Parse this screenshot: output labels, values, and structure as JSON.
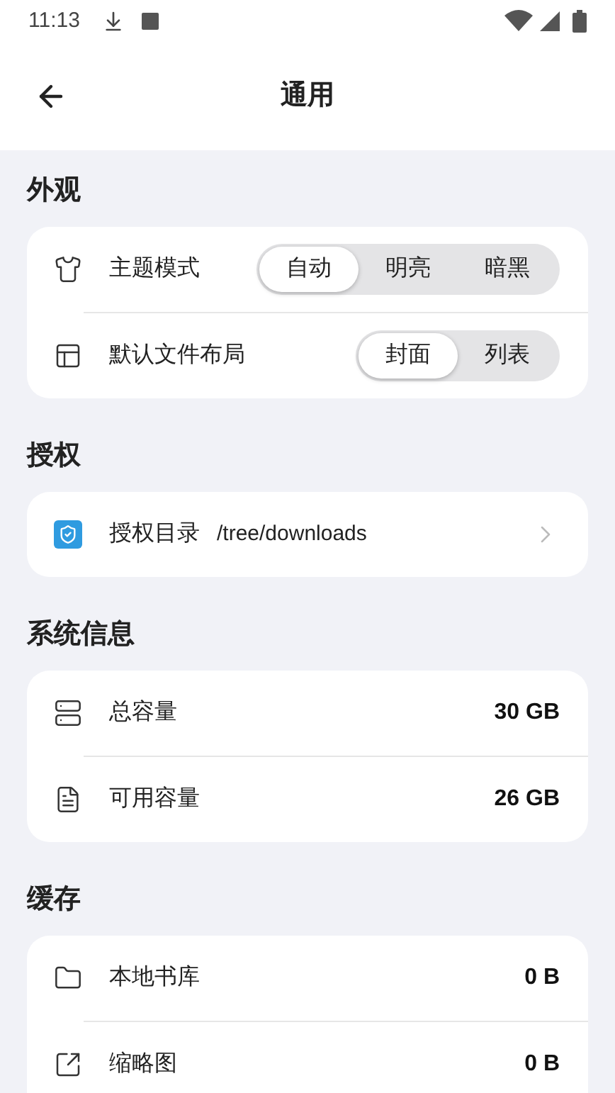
{
  "status_bar": {
    "time": "11:13"
  },
  "header": {
    "title": "通用"
  },
  "sections": [
    {
      "title": "外观",
      "rows": [
        {
          "kind": "segmented",
          "label": "主题模式",
          "options": [
            {
              "label": "自动",
              "selected": true
            },
            {
              "label": "明亮",
              "selected": false
            },
            {
              "label": "暗黑",
              "selected": false
            }
          ]
        },
        {
          "kind": "segmented",
          "label": "默认文件布局",
          "options": [
            {
              "label": "封面",
              "selected": true
            },
            {
              "label": "列表",
              "selected": false
            }
          ]
        }
      ]
    },
    {
      "title": "授权",
      "rows": [
        {
          "kind": "link",
          "label": "授权目录",
          "value": "/tree/downloads"
        }
      ]
    },
    {
      "title": "系统信息",
      "rows": [
        {
          "kind": "value",
          "label": "总容量",
          "value": "30 GB"
        },
        {
          "kind": "value",
          "label": "可用容量",
          "value": "26 GB"
        }
      ]
    },
    {
      "title": "缓存",
      "rows": [
        {
          "kind": "value",
          "label": "本地书库",
          "value": "0 B"
        },
        {
          "kind": "value",
          "label": "缩略图",
          "value": "0 B"
        }
      ]
    }
  ]
}
